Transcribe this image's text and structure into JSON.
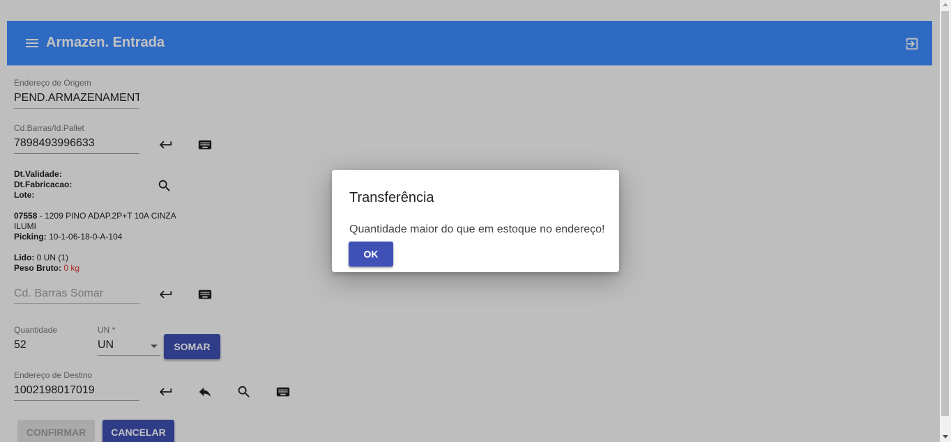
{
  "header": {
    "title": "Armazen. Entrada",
    "menu_icon": "menu-icon",
    "exit_icon": "exit-to-app-icon",
    "color": "#3f8cff"
  },
  "form": {
    "origin": {
      "label": "Endereço de Origem",
      "value": "PEND.ARMAZENAMENTO"
    },
    "barcode": {
      "label": "Cd.Barras/Id.Pallet",
      "value": "7898493996633"
    },
    "dates": {
      "validade_label": "Dt.Validade:",
      "fabricacao_label": "Dt.Fabricacao:",
      "lote_label": "Lote:"
    },
    "product": {
      "code": "07558",
      "sep": " - ",
      "description": "1209 PINO ADAP.2P+T 10A CINZA ILUMI",
      "picking_label": "Picking:",
      "picking_value": " 10-1-06-18-0-A-104"
    },
    "read": {
      "lido_label": "Lido:",
      "lido_value": " 0 UN (1)",
      "peso_label": "Peso Bruto:",
      "peso_value": " 0 kg"
    },
    "sum_barcode": {
      "placeholder": "Cd. Barras Somar"
    },
    "quantity": {
      "label": "Quantidade",
      "value": "52"
    },
    "unit": {
      "label": "UN *",
      "value": "UN"
    },
    "sum_button": "SOMAR",
    "destination": {
      "label": "Endereço de Destino",
      "value": "1002198017019"
    },
    "confirm_button": "CONFIRMAR",
    "cancel_button": "CANCELAR"
  },
  "dialog": {
    "title": "Transferência",
    "message": "Quantidade maior do que em estoque no endereço!",
    "ok_button": "OK"
  },
  "colors": {
    "primary_button": "#3f51b5",
    "error": "#e53935"
  }
}
